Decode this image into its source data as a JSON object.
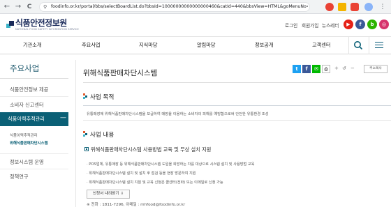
{
  "browser": {
    "back": "←",
    "forward": "→",
    "reload": "C",
    "url": "foodinfo.or.kr/portal/bbs/selectBoardList.do?bbsId=10000000000000000460&catId=440&bbsView=HTML&goMenuNo=90000..."
  },
  "header": {
    "logo_text": "식품안전정보원",
    "logo_sub": "NATIONAL FOOD SAFETY INFORMATION SERVICE",
    "util_links": [
      "로그인",
      "회원가입",
      "뉴스레터"
    ],
    "sns": [
      "▶",
      "f",
      "b",
      "◎"
    ]
  },
  "gnb": {
    "items": [
      "기관소개",
      "주요사업",
      "지식마당",
      "알림마당",
      "정보공개",
      "고객센터"
    ]
  },
  "sidebar": {
    "title": "주요사업",
    "items": [
      "식품안전정보 제공",
      "소비자 신고센터"
    ],
    "active": "식품이력추적관리",
    "active_sign": "—",
    "sub_items": [
      "식품이력추적관리",
      "위해식품판매차단시스템"
    ],
    "bottom_items": [
      "정보시스템 운영",
      "정책연구"
    ]
  },
  "content": {
    "title": "위해식품판매차단시스템",
    "share": [
      "t",
      "f",
      "✉"
    ],
    "tools": [
      "⎙",
      "+",
      "↺",
      "−"
    ],
    "page_btn": "주소복사",
    "purpose_title": "사업 목적",
    "purpose_text": "유통매장에 위해식품판매차단시스템을 보급하여 매장을 이용하는 소비자의 피해를 예방함으로써 안전한 유통환경 조성",
    "details_title": "사업 내용",
    "sub_head": "위해식품판매차단시스템 사용방법 교육 및 무상 설치 지원",
    "lines": [
      "· POS업체, 유통매장 등 위해식품판매차단시스템 도입을 희망하는 자를 대상으로 시스템 설치 및 사용방법 교육",
      "· 위해식품판매차단시스템 설치 및 설치 후 점검 등을 현장 방문하여 지원",
      "· 위해식품판매차단시스템 설치 지원 및 교육 신청은 콜센터(전화) 또는 이메일로 신청 가능"
    ],
    "apply_btn": "신청서 내려받기 ⇩",
    "contact": "※ 전화 : 1811-7296, 이메일 : mhfood@foodinfo.or.kr"
  },
  "colors": {
    "primary": "#0b6076",
    "twitter": "#1da1f2",
    "facebook": "#3b5998",
    "line": "#00b900",
    "youtube": "#e62117",
    "kakao": "#3b5998",
    "blog": "#2db400",
    "instagram": "#d6336c"
  }
}
